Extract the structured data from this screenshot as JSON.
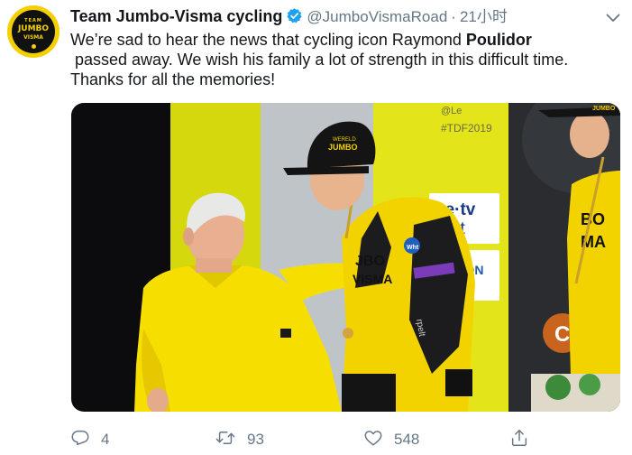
{
  "tweet": {
    "account_name": "Team Jumbo-Visma cycling",
    "handle": "@JumboVismaRoad",
    "separator": "·",
    "time": "21小时",
    "text_lines": [
      [
        "We’re sad to hear the news that cycling icon Raymond ",
        "Poulidor"
      ],
      [
        " passed away. We wish his family a lot of strength in this difficult time."
      ],
      [
        "Thanks for all the memories!"
      ]
    ],
    "avatar": {
      "line1": "TEAM",
      "line2": "JUMBO",
      "line3": "VISMA"
    },
    "photo": {
      "banner_hashtag_1": "@Le",
      "banner_hashtag_2": "#TDF2019",
      "sponsor_1_line1": "ce·tv",
      "sponsor_1_line2": "port",
      "sponsor_2": "VISION",
      "cap_brand_small": "WERELD",
      "cap_brand": "JUMBO",
      "jersey_rider_line1": "JBO",
      "jersey_rider_line2": "VISMA",
      "jersey_right_line1": "BO",
      "jersey_right_line2": "MA",
      "sleeve_text": "rpelt",
      "wht_badge": "Wht",
      "cap_right_text": "JUMBO",
      "credit_logo": "C"
    }
  },
  "actions": {
    "reply_count": "4",
    "retweet_count": "93",
    "like_count": "548"
  },
  "colors": {
    "verified": "#1da1f2",
    "jumbo_yellow": "#f5d000",
    "secondary_text": "#657786"
  }
}
